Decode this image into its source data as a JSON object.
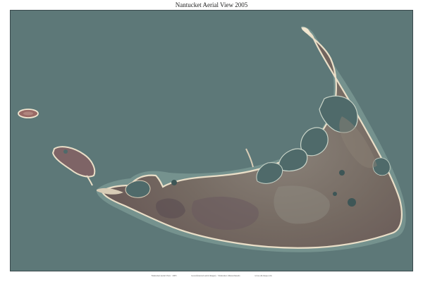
{
  "map": {
    "title": "Nantucket Aerial View  2005",
    "colors": {
      "water": "#5d7878",
      "land": "#7a6e66",
      "beach": "#e8dcc6",
      "pond": "#4f6a6a",
      "shallow": "#87a8a0"
    }
  },
  "footer": {
    "left": "Nantucket Aerial View · 2005",
    "center": "Georeferenced aerial imagery · Nantucket, Massachusetts",
    "right": "www.old-maps.com"
  }
}
